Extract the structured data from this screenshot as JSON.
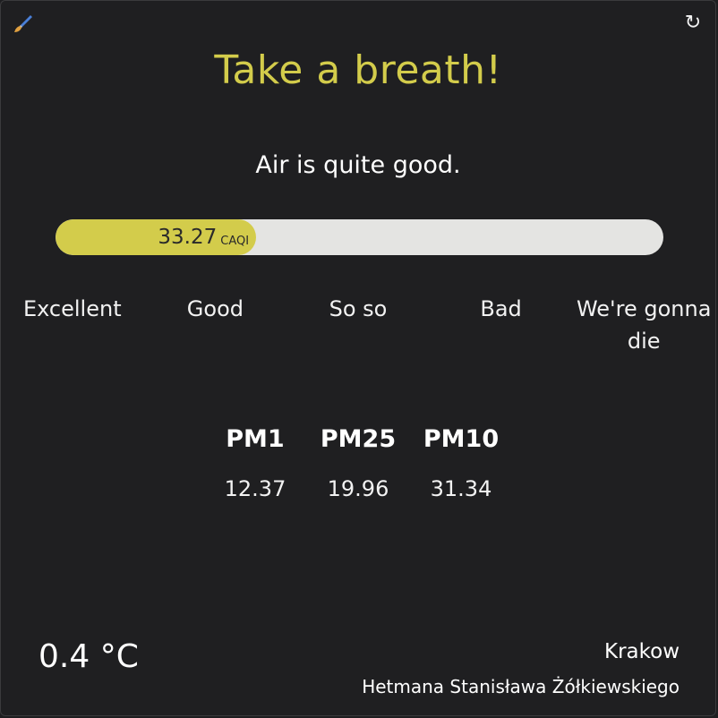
{
  "header": {
    "title": "Take a breath!",
    "status": "Air is quite good.",
    "title_color": "#d3cc4b"
  },
  "icons": {
    "left": "paintbrush-icon",
    "right": "refresh-icon",
    "refresh_glyph": "↻"
  },
  "gauge": {
    "value": "33.27",
    "unit": "CAQI",
    "fill_fraction": 0.33,
    "fill_color": "#d3cc4b",
    "track_color": "#e4e4e2"
  },
  "scale": [
    {
      "label": "Excellent"
    },
    {
      "label": "Good"
    },
    {
      "label": "So so"
    },
    {
      "label": "Bad"
    },
    {
      "label": "We're gonna die"
    }
  ],
  "pm": [
    {
      "name": "PM1",
      "value": "12.37"
    },
    {
      "name": "PM25",
      "value": "19.96"
    },
    {
      "name": "PM10",
      "value": "31.34"
    }
  ],
  "weather": {
    "temperature": "0.4 °C"
  },
  "location": {
    "city": "Krakow",
    "street": "Hetmana Stanisława Żółkiewskiego"
  }
}
